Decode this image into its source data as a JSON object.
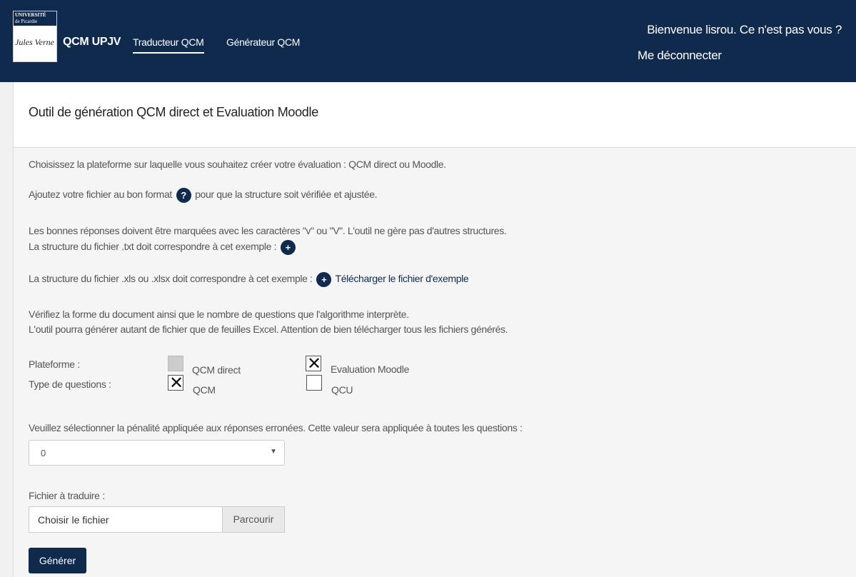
{
  "header": {
    "logo": {
      "top_line": "UNIVERSITÉ",
      "sub_line": "de Picardie",
      "signature": "Jules Verne"
    },
    "brand": "QCM UPJV",
    "nav": [
      {
        "label": "Traducteur QCM",
        "active": true
      },
      {
        "label": "Générateur QCM",
        "active": false
      }
    ],
    "welcome": "Bienvenue lisrou. Ce n'est pas vous ?",
    "logout": "Me déconnecter"
  },
  "panel": {
    "title": "Outil de génération QCM direct et Evaluation Moodle",
    "paragraphs": {
      "p1": "Choisissez la plateforme sur laquelle vous souhaitez créer votre évaluation : QCM direct ou Moodle.",
      "p2_before": "Ajoutez votre fichier au bon format",
      "p2_after": "pour que la structure soit vérifiée et ajustée.",
      "p3_line1": "Les bonnes réponses doivent être marquées avec les caractères \"v\" ou \"V\". L'outil ne gère pas d'autres structures.",
      "p3_line2": "La structure du fichier .txt doit correspondre à cet exemple :",
      "p4": "La structure du fichier .xls ou .xlsx doit correspondre à cet exemple :",
      "p4_link": "Télécharger le fichier d'exemple",
      "p5_line1": "Vérifiez la forme du document ainsi que le nombre de questions que l'algorithme interprète.",
      "p5_line2": "L'outil pourra générer autant de fichier que de feuilles Excel. Attention de bien télécharger tous les fichiers générés."
    },
    "icons": {
      "help": "?",
      "plus": "+"
    },
    "options": {
      "platform_label": "Plateforme :",
      "platform": [
        {
          "label": "QCM direct",
          "checked": false,
          "disabled": true
        },
        {
          "label": "Evaluation Moodle",
          "checked": true,
          "disabled": false
        }
      ],
      "type_label": "Type de questions :",
      "type": [
        {
          "label": "QCM",
          "checked": true
        },
        {
          "label": "QCU",
          "checked": false
        }
      ],
      "check_mark": "✕"
    },
    "penalty": {
      "label": "Veuillez sélectionner la pénalité appliquée aux réponses erronées. Cette valeur sera appliquée à toutes les questions :",
      "value": "0",
      "arrow": "▼"
    },
    "file": {
      "label": "Fichier à traduire :",
      "placeholder": "Choisir le fichier",
      "browse": "Parcourir"
    },
    "submit": "Générer"
  },
  "colors": {
    "navy": "#0f2a4d",
    "panel_bg": "#f5f5f5"
  }
}
